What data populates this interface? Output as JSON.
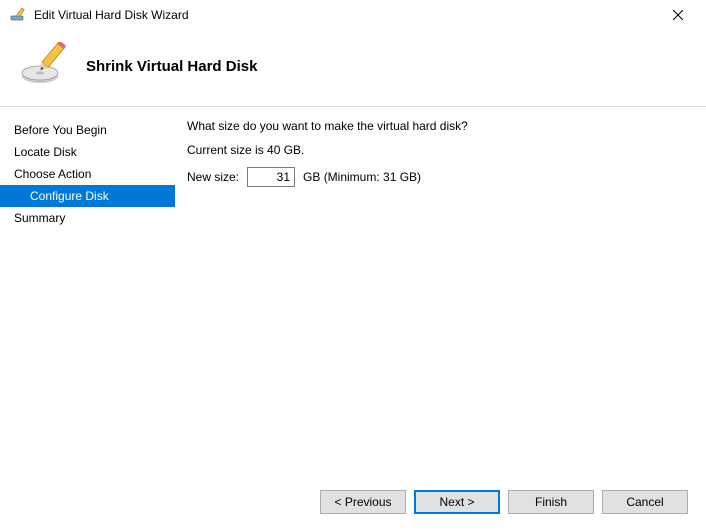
{
  "titlebar": {
    "title": "Edit Virtual Hard Disk Wizard"
  },
  "header": {
    "heading": "Shrink Virtual Hard Disk"
  },
  "sidebar": {
    "steps": [
      {
        "label": "Before You Begin"
      },
      {
        "label": "Locate Disk"
      },
      {
        "label": "Choose Action"
      },
      {
        "label": "Configure Disk"
      },
      {
        "label": "Summary"
      }
    ]
  },
  "content": {
    "prompt": "What size do you want to make the virtual hard disk?",
    "current_size_text": "Current size is 40 GB.",
    "new_size_label": "New size:",
    "new_size_value": "31",
    "unit_and_min": "GB (Minimum: 31 GB)"
  },
  "footer": {
    "previous": "< Previous",
    "next": "Next >",
    "finish": "Finish",
    "cancel": "Cancel"
  }
}
